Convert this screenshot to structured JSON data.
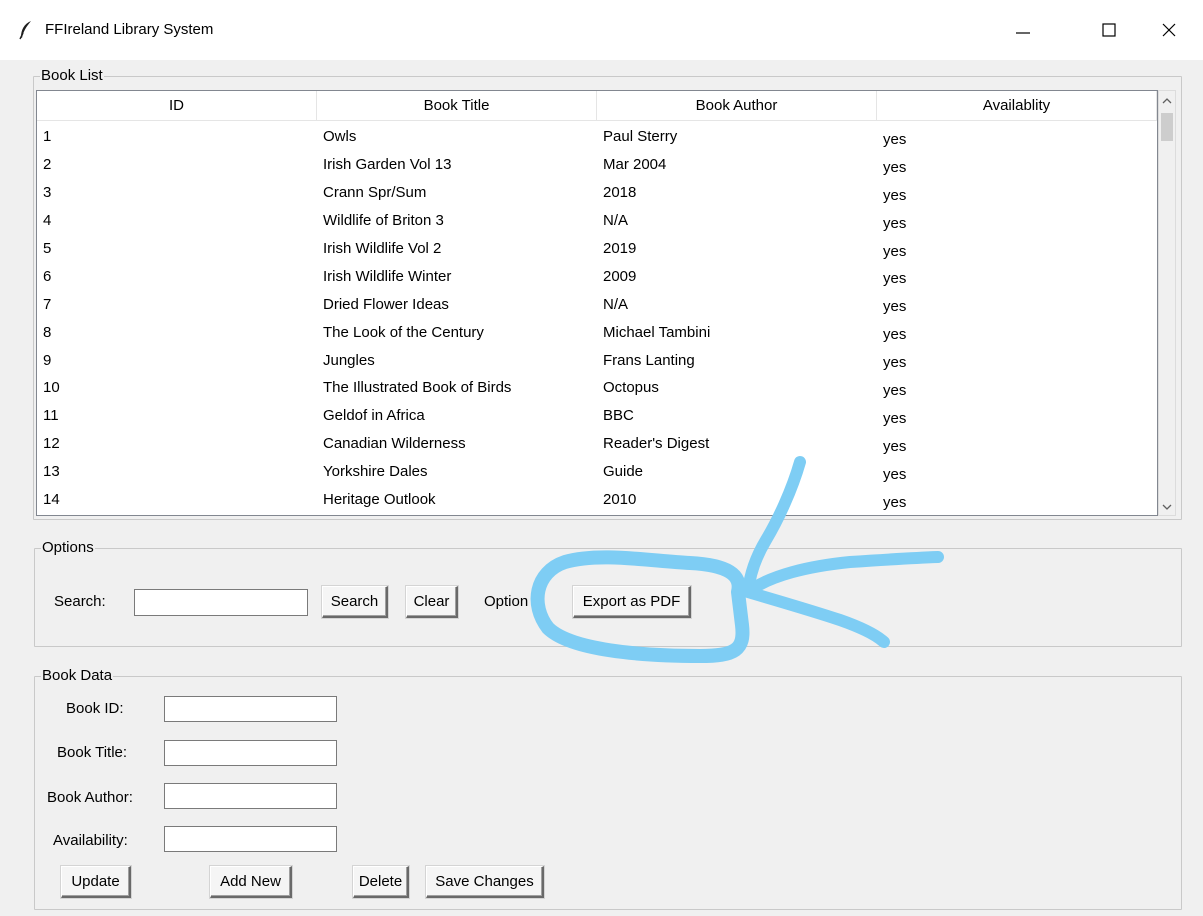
{
  "window": {
    "title": "FFIreland Library System",
    "icon": "feather-icon",
    "controls": {
      "minimize": "minimize-icon",
      "maximize": "maximize-icon",
      "close": "close-icon"
    }
  },
  "book_list": {
    "label": "Book List",
    "columns": [
      "ID",
      "Book Title",
      "Book Author",
      "Availablity"
    ],
    "rows": [
      [
        "1",
        "Owls",
        "Paul Sterry",
        "yes"
      ],
      [
        "2",
        "Irish Garden Vol 13",
        "Mar 2004",
        "yes"
      ],
      [
        "3",
        "Crann Spr/Sum",
        "2018",
        "yes"
      ],
      [
        "4",
        "Wildlife of Briton 3",
        "N/A",
        "yes"
      ],
      [
        "5",
        "Irish Wildlife Vol 2",
        "2019",
        "yes"
      ],
      [
        "6",
        "Irish Wildlife Winter",
        "2009",
        "yes"
      ],
      [
        "7",
        "Dried Flower Ideas",
        "N/A",
        "yes"
      ],
      [
        "8",
        "The Look of the Century",
        "Michael Tambini",
        "yes"
      ],
      [
        "9",
        "Jungles",
        "Frans Lanting",
        "yes"
      ],
      [
        "10",
        "The Illustrated Book of Birds",
        "Octopus",
        "yes"
      ],
      [
        "11",
        "Geldof in Africa",
        "BBC",
        "yes"
      ],
      [
        "12",
        "Canadian Wilderness",
        "Reader's Digest",
        "yes"
      ],
      [
        "13",
        "Yorkshire Dales",
        "Guide",
        "yes"
      ],
      [
        "14",
        "Heritage Outlook",
        "2010",
        "yes"
      ]
    ]
  },
  "options": {
    "label": "Options",
    "search_label": "Search:",
    "search_value": "",
    "search_button": "Search",
    "clear_button": "Clear",
    "option_label": "Option",
    "export_button": "Export as PDF"
  },
  "book_data": {
    "label": "Book Data",
    "id_label": "Book ID:",
    "title_label": "Book Title:",
    "author_label": "Book Author:",
    "availability_label": "Availability:",
    "id_value": "",
    "title_value": "",
    "author_value": "",
    "availability_value": "",
    "update_button": "Update",
    "add_button": "Add New",
    "delete_button": "Delete",
    "save_button": "Save Changes"
  },
  "annotation": {
    "color": "#7ecdf4"
  }
}
